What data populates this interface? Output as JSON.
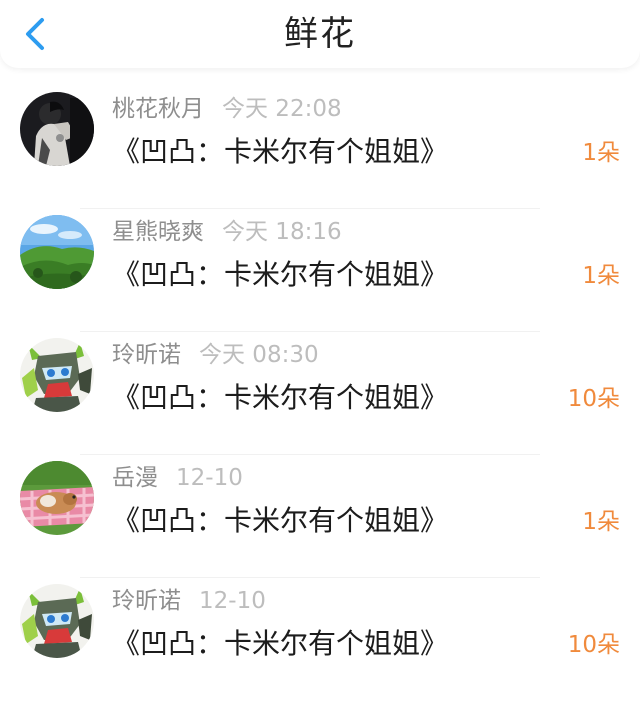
{
  "header": {
    "title": "鲜花",
    "back_icon": "chevron-left-icon",
    "accent_color": "#2d9cf0"
  },
  "flowers": [
    {
      "user": "桃花秋月",
      "time": "今天 22:08",
      "work": "《凹凸：卡米尔有个姐姐》",
      "count": "1朵",
      "avatar": "portrait-dark-avatar"
    },
    {
      "user": "星熊晓爽",
      "time": "今天 18:16",
      "work": "《凹凸：卡米尔有个姐姐》",
      "count": "1朵",
      "avatar": "landscape-hills-avatar"
    },
    {
      "user": "玲昕诺",
      "time": "今天 08:30",
      "work": "《凹凸：卡米尔有个姐姐》",
      "count": "10朵",
      "avatar": "anime-character-avatar"
    },
    {
      "user": "岳漫",
      "time": "12-10",
      "work": "《凹凸：卡米尔有个姐姐》",
      "count": "1朵",
      "avatar": "pet-on-grass-avatar"
    },
    {
      "user": "玲昕诺",
      "time": "12-10",
      "work": "《凹凸：卡米尔有个姐姐》",
      "count": "10朵",
      "avatar": "anime-character-avatar"
    }
  ],
  "colors": {
    "count": "#f08a3c",
    "username": "#8e8e8e",
    "time": "#bdbdbd",
    "work": "#1c1c1c"
  }
}
